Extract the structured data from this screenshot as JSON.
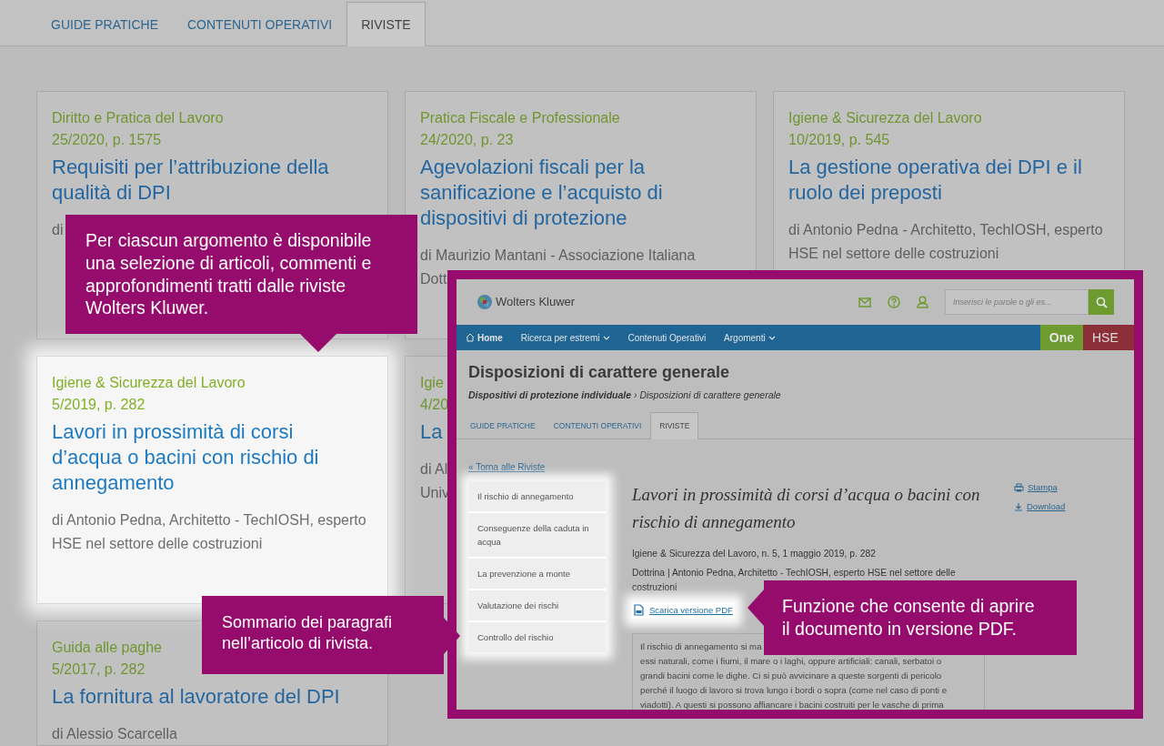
{
  "tabs": [
    {
      "label": "GUIDE PRATICHE",
      "selected": false
    },
    {
      "label": "CONTENUTI OPERATIVI",
      "selected": false
    },
    {
      "label": "RIVISTE",
      "selected": true
    }
  ],
  "cards": [
    {
      "source": "Diritto e Pratica del Lavoro",
      "issue": "25/2020, p. 1575",
      "title": "Requisiti per l’attribuzione della qualità di DPI",
      "author_lines": [
        "di"
      ],
      "highlighted": false
    },
    {
      "source": "Pratica Fiscale e Professionale",
      "issue": "24/2020, p. 23",
      "title": "Agevolazioni fiscali per la sanificazione e l’acquisto di dispositivi di protezione",
      "author_lines": [
        "di Maurizio Mantani - Associazione Italiana",
        "Dott"
      ],
      "highlighted": false
    },
    {
      "source": "Igiene & Sicurezza del Lavoro",
      "issue": "10/2019, p. 545",
      "title": "La gestione operativa dei DPI e il ruolo dei preposti",
      "author_lines": [
        "di Antonio Pedna - Architetto, TechIOSH, esperto",
        "HSE nel settore delle costruzioni"
      ],
      "highlighted": false
    },
    {
      "source": "Igiene & Sicurezza del Lavoro",
      "issue": "5/2019, p. 282",
      "title": "Lavori in prossimità di corsi d’acqua o bacini con rischio di annegamento",
      "author_lines": [
        "di Antonio Pedna, Architetto - TechIOSH, esperto",
        "HSE nel settore delle costruzioni"
      ],
      "highlighted": true
    },
    {
      "source": "Igie",
      "issue": "4/20",
      "title": "La",
      "author_lines": [
        "di Al",
        "Univ"
      ],
      "highlighted": false
    },
    {
      "source": "Guida alle paghe",
      "issue": "5/2017, p. 282",
      "title": "La fornitura al lavoratore del DPI",
      "author_lines": [
        "di Alessio Scarcella"
      ],
      "highlighted": false
    }
  ],
  "inset": {
    "logo": "Wolters Kluwer",
    "search": {
      "placeholder": "Inserisci le parole o gli es..."
    },
    "nav": [
      {
        "label": "Home",
        "kind": "home"
      },
      {
        "label": "Ricerca per estremi",
        "kind": "dropdown"
      },
      {
        "label": "Contenuti Operativi",
        "kind": "link"
      },
      {
        "label": "Argomenti",
        "kind": "dropdown"
      }
    ],
    "brand_badges": [
      "One",
      "HSE"
    ],
    "title": "Disposizioni di carattere generale",
    "breadcrumb": "**Dispositivi di protezione individuale** › Disposizioni di carattere generale",
    "tabs": [
      {
        "label": "GUIDE PRATICHE",
        "selected": false
      },
      {
        "label": "CONTENUTI OPERATIVI",
        "selected": false
      },
      {
        "label": "RIVISTE",
        "selected": true
      }
    ],
    "back_link": "« Torna alle Riviste",
    "toc": [
      "Il rischio di annegamento",
      "Conseguenze della caduta in acqua",
      "La prevenzione a monte",
      "Valutazione dei rischi",
      "Controllo del rischio"
    ],
    "article_title": "Lavori in prossimità di corsi d’acqua o bacini con rischio di annegamento",
    "meta": "Igiene & Sicurezza del Lavoro, n. 5, 1 maggio 2019, p. 282",
    "byline": "Dottrina | Antonio Pedna, Architetto - TechIOSH, esperto HSE nel settore delle costruzioni",
    "pdf_link": "Scarica versione PDF",
    "actions": [
      {
        "label": "Stampa",
        "kind": "print"
      },
      {
        "label": "Download",
        "kind": "download"
      }
    ],
    "text_lines": [
      "Il rischio di annegamento si ma",
      "essi naturali, come i fiumi, il mare o i laghi, oppure artificiali: canali, serbatoi o",
      "grandi bacini come le dighe. Ci si può avvicinare a queste sorgenti di pericolo",
      "perché il luogo di lavoro si trova lungo i bordi o sopra (come nel caso di ponti e",
      "viadotti). A questi si possono affiancare i bacini costruiti per le vasche di prima"
    ]
  },
  "callouts": [
    {
      "text": "Per ciascun argomento è disponibile una selezione di articoli, commenti e  approfondimenti tratti dalle riviste Wolters Kluwer."
    },
    {
      "text": "Sommario dei paragrafi nell’articolo di rivista."
    },
    {
      "text": "Funzione che consente di aprire il documento in versione PDF."
    }
  ]
}
